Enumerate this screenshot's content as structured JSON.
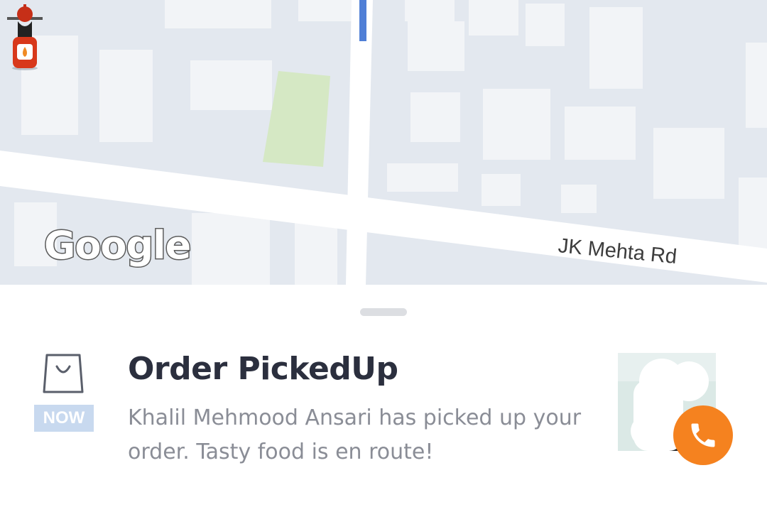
{
  "map": {
    "provider_logo": "Google",
    "road_label": "JK Mehta Rd",
    "courier_icon": "delivery-scooter-icon"
  },
  "order_card": {
    "icon": "shopping-bag-icon",
    "badge": "NOW",
    "title": "Order PickedUp",
    "message": "Khalil Mehmood Ansari has picked up your order. Tasty food is en route!"
  },
  "driver": {
    "avatar_icon": "driver-avatar",
    "call_icon": "phone-icon"
  },
  "colors": {
    "accent": "#f5821f",
    "badge_bg": "#c8d9ef",
    "title": "#2b2f3e",
    "body_text": "#8a8d96",
    "map_bg": "#e3e8ef",
    "park": "#d5e8c4"
  }
}
